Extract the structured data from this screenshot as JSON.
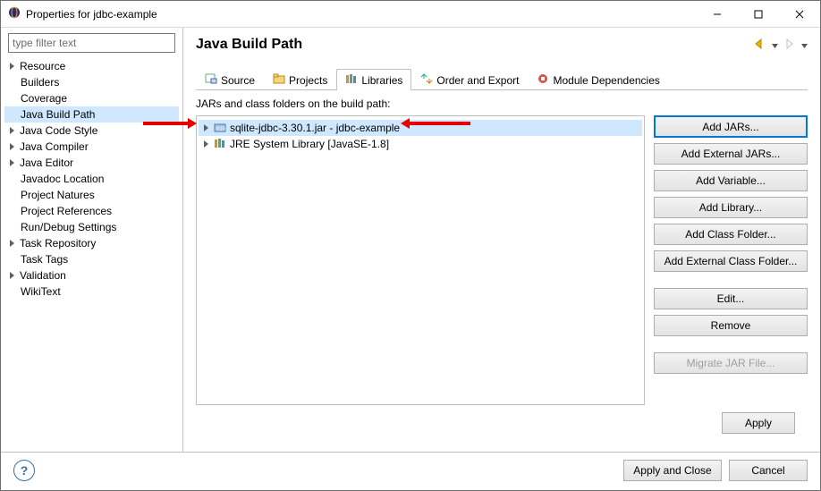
{
  "window": {
    "title": "Properties for jdbc-example"
  },
  "filter": {
    "placeholder": "type filter text"
  },
  "sidebar": {
    "items": [
      {
        "label": "Resource",
        "exp": true
      },
      {
        "label": "Builders",
        "exp": false
      },
      {
        "label": "Coverage",
        "exp": false
      },
      {
        "label": "Java Build Path",
        "exp": false,
        "sel": true
      },
      {
        "label": "Java Code Style",
        "exp": true
      },
      {
        "label": "Java Compiler",
        "exp": true
      },
      {
        "label": "Java Editor",
        "exp": true
      },
      {
        "label": "Javadoc Location",
        "exp": false
      },
      {
        "label": "Project Natures",
        "exp": false
      },
      {
        "label": "Project References",
        "exp": false
      },
      {
        "label": "Run/Debug Settings",
        "exp": false
      },
      {
        "label": "Task Repository",
        "exp": true
      },
      {
        "label": "Task Tags",
        "exp": false
      },
      {
        "label": "Validation",
        "exp": true
      },
      {
        "label": "WikiText",
        "exp": false
      }
    ]
  },
  "page": {
    "title": "Java Build Path"
  },
  "tabs": [
    {
      "label": "Source"
    },
    {
      "label": "Projects"
    },
    {
      "label": "Libraries",
      "active": true
    },
    {
      "label": "Order and Export"
    },
    {
      "label": "Module Dependencies"
    }
  ],
  "subtitle": "JARs and class folders on the build path:",
  "entries": [
    {
      "label": "sqlite-jdbc-3.30.1.jar - jdbc-example",
      "sel": true,
      "icon": "jar"
    },
    {
      "label": "JRE System Library [JavaSE-1.8]",
      "sel": false,
      "icon": "lib"
    }
  ],
  "buttons": {
    "add_jars": "Add JARs...",
    "add_ext_jars": "Add External JARs...",
    "add_var": "Add Variable...",
    "add_lib": "Add Library...",
    "add_cf": "Add Class Folder...",
    "add_ext_cf": "Add External Class Folder...",
    "edit": "Edit...",
    "remove": "Remove",
    "migrate": "Migrate JAR File..."
  },
  "footer": {
    "apply": "Apply",
    "apply_close": "Apply and Close",
    "cancel": "Cancel"
  }
}
